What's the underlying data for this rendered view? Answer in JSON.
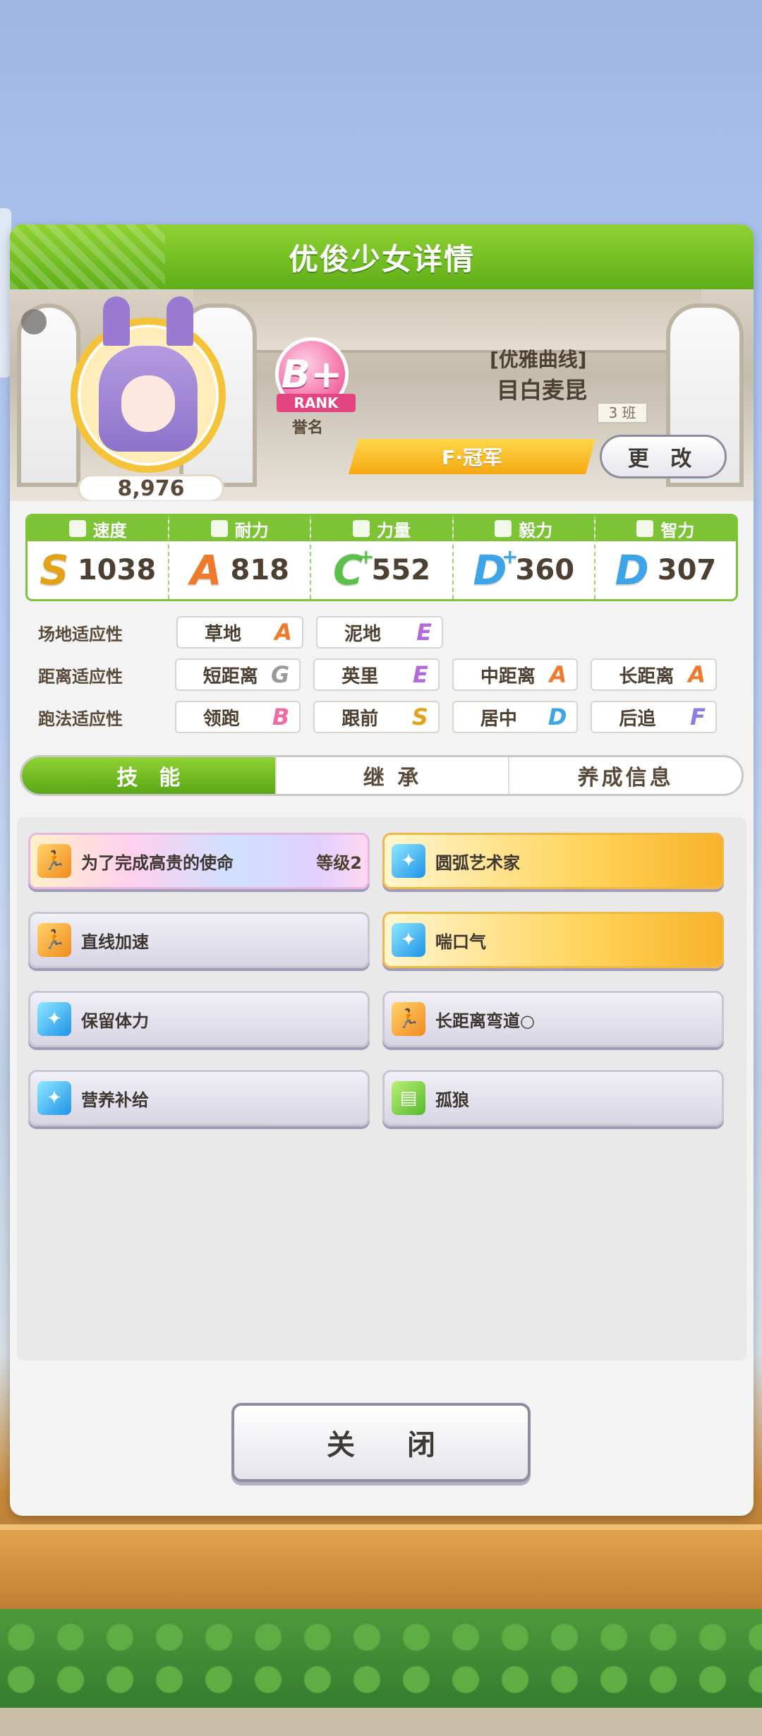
{
  "header": {
    "title": "优俊少女详情"
  },
  "profile": {
    "fans": "8,976",
    "rank": "B+",
    "rank_ribbon": "RANK",
    "rank_title": "誉名",
    "epithet": "[优雅曲线]",
    "name": "目白麦昆",
    "class_tag": "3 班",
    "title": "F·冠军",
    "change_label": "更 改"
  },
  "stats": [
    {
      "label": "速度",
      "grade": "S",
      "plus": "",
      "value": "1038",
      "icon": "shoe-icon"
    },
    {
      "label": "耐力",
      "grade": "A",
      "plus": "",
      "value": "818",
      "icon": "heart-icon"
    },
    {
      "label": "力量",
      "grade": "C",
      "plus": "+",
      "value": "552",
      "icon": "muscle-icon"
    },
    {
      "label": "毅力",
      "grade": "D",
      "plus": "+",
      "value": "360",
      "icon": "flame-icon"
    },
    {
      "label": "智力",
      "grade": "D",
      "plus": "",
      "value": "307",
      "icon": "graduation-cap-icon"
    }
  ],
  "aptitudes": {
    "track": {
      "label": "场地适应性",
      "items": [
        {
          "name": "草地",
          "grade": "A"
        },
        {
          "name": "泥地",
          "grade": "E"
        }
      ]
    },
    "distance": {
      "label": "距离适应性",
      "items": [
        {
          "name": "短距离",
          "grade": "G"
        },
        {
          "name": "英里",
          "grade": "E"
        },
        {
          "name": "中距离",
          "grade": "A"
        },
        {
          "name": "长距离",
          "grade": "A"
        }
      ]
    },
    "strategy": {
      "label": "跑法适应性",
      "items": [
        {
          "name": "领跑",
          "grade": "B"
        },
        {
          "name": "跟前",
          "grade": "S"
        },
        {
          "name": "居中",
          "grade": "D"
        },
        {
          "name": "后追",
          "grade": "F"
        }
      ]
    }
  },
  "tabs": [
    {
      "label": "技能"
    },
    {
      "label": "继 承"
    },
    {
      "label": "养成信息"
    }
  ],
  "skills": [
    {
      "name": "为了完成高贵的使命",
      "level": "等级2",
      "style": "rainbow",
      "icon": "running-icon"
    },
    {
      "name": "圆弧艺术家",
      "level": "",
      "style": "gold",
      "icon": "sparkle-icon"
    },
    {
      "name": "直线加速",
      "level": "",
      "style": "normal",
      "icon": "running-icon"
    },
    {
      "name": "喘口气",
      "level": "",
      "style": "gold",
      "icon": "sparkle-icon"
    },
    {
      "name": "保留体力",
      "level": "",
      "style": "normal",
      "icon": "sparkle-icon"
    },
    {
      "name": "长距离弯道○",
      "level": "",
      "style": "normal",
      "icon": "running-icon"
    },
    {
      "name": "营养补给",
      "level": "",
      "style": "normal",
      "icon": "sparkle-icon"
    },
    {
      "name": "孤狼",
      "level": "",
      "style": "normal",
      "icon": "card-icon"
    }
  ],
  "close_label": "关 闭",
  "colors": {
    "header_green": "#6fbf24",
    "accent_gold": "#f5a812",
    "rank_pink": "#f26aa4"
  }
}
